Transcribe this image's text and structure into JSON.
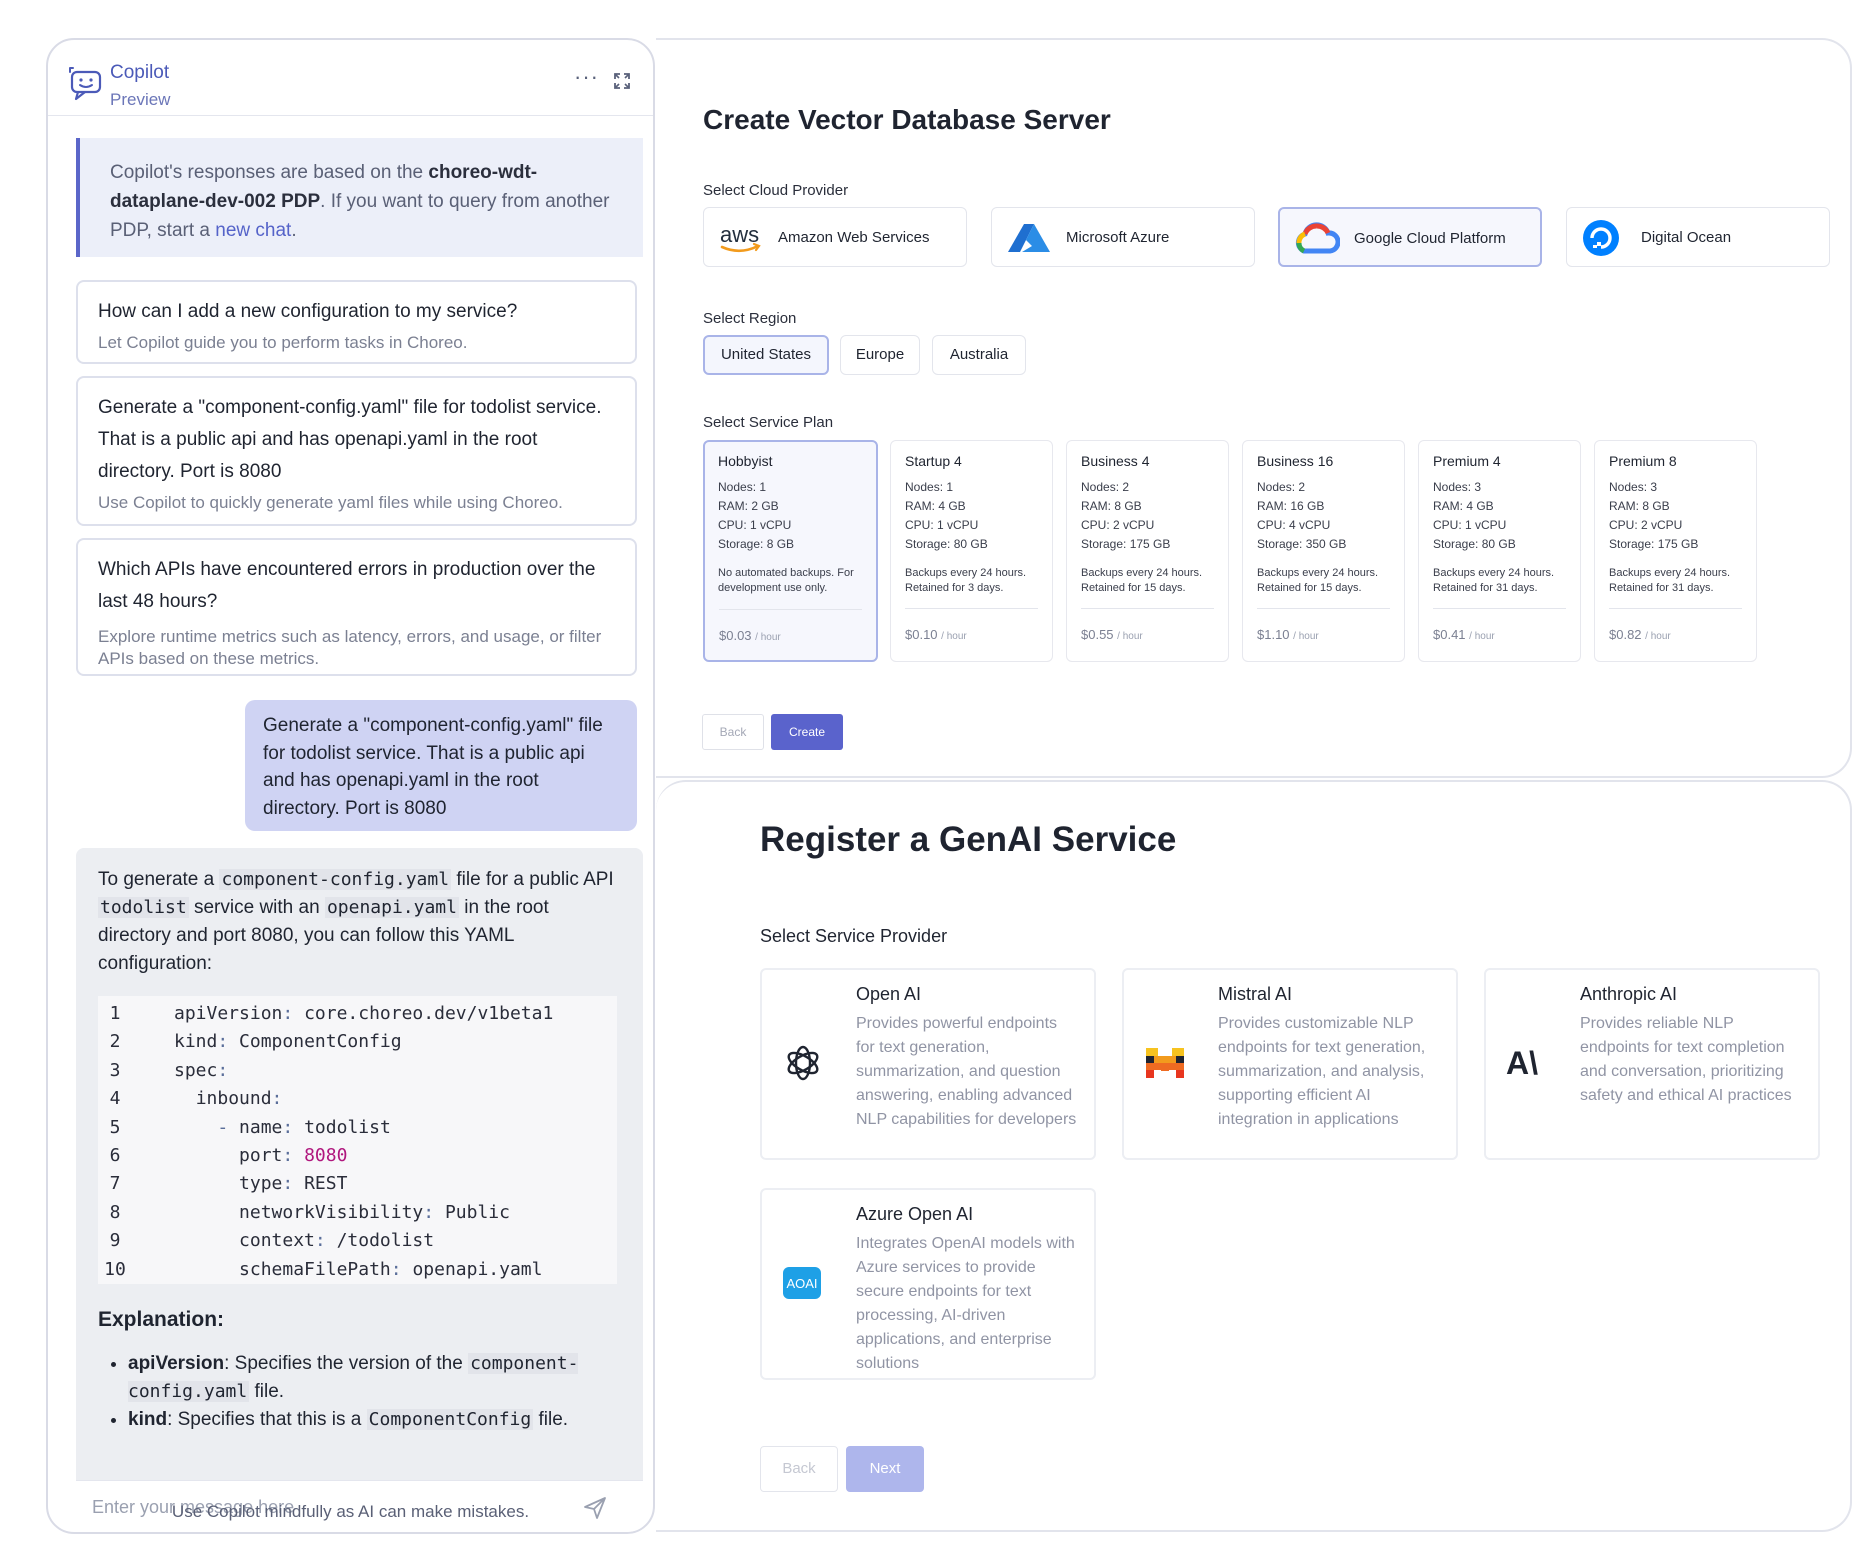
{
  "copilot": {
    "title": "Copilot",
    "subtitle": "Preview",
    "more": "···",
    "info": {
      "prefix": "Copilot's responses are based on the ",
      "pdp": "choreo-wdt-dataplane-dev-002 PDP",
      "middle": ". If you want to query from another PDP, start a ",
      "link": "new chat",
      "suffix": "."
    },
    "suggestions": [
      {
        "question": "How can I add a new configuration to my service?",
        "desc": "Let Copilot guide you to perform tasks in Choreo."
      },
      {
        "question": "Generate a \"component-config.yaml\" file for todolist service. That is a public api and has openapi.yaml in the root directory. Port is 8080",
        "desc": "Use Copilot to quickly generate yaml files while using Choreo."
      },
      {
        "question": "Which APIs have encountered errors in production over the last 48 hours?",
        "desc": "Explore runtime metrics such as latency, errors, and usage, or filter APIs based on these metrics."
      }
    ],
    "user_message": "Generate a \"component-config.yaml\" file for todolist service. That is a public api and has openapi.yaml in the root directory. Port is 8080",
    "response": {
      "t1": "To generate a ",
      "c1": "component-config.yaml",
      "t2": " file for a public API ",
      "c2": "todolist",
      "t3": " service with an ",
      "c3": "openapi.yaml",
      "t4": " in the root directory and port 8080, you can follow this YAML configuration:",
      "code": [
        {
          "n": "1",
          "indent": "",
          "dash": "",
          "key": "apiVersion",
          "val": "core.choreo.dev/v1beta1"
        },
        {
          "n": "2",
          "indent": "",
          "dash": "",
          "key": "kind",
          "val": "ComponentConfig"
        },
        {
          "n": "3",
          "indent": "",
          "dash": "",
          "key": "spec",
          "val": ""
        },
        {
          "n": "4",
          "indent": "  ",
          "dash": "",
          "key": "inbound",
          "val": ""
        },
        {
          "n": "5",
          "indent": "    ",
          "dash": "- ",
          "key": "name",
          "val": "todolist"
        },
        {
          "n": "6",
          "indent": "      ",
          "dash": "",
          "key": "port",
          "val": "8080"
        },
        {
          "n": "7",
          "indent": "      ",
          "dash": "",
          "key": "type",
          "val": "REST"
        },
        {
          "n": "8",
          "indent": "      ",
          "dash": "",
          "key": "networkVisibility",
          "val": "Public"
        },
        {
          "n": "9",
          "indent": "      ",
          "dash": "",
          "key": "context",
          "val": "/todolist"
        },
        {
          "n": "10",
          "indent": "      ",
          "dash": "",
          "key": "schemaFilePath",
          "val": "openapi.yaml"
        }
      ],
      "explanation_title": "Explanation:",
      "bullets": [
        {
          "term": "apiVersion",
          "text1": ": Specifies the version of the ",
          "code": "component-config.yaml",
          "text2": " file."
        },
        {
          "term": "kind",
          "text1": ": Specifies that this is a ",
          "code": "ComponentConfig",
          "text2": " file."
        }
      ]
    },
    "input_placeholder": "Enter your message here",
    "footer": "Use Copilot mindfully as AI can make mistakes."
  },
  "vector_db": {
    "title": "Create Vector Database Server",
    "cloud_label": "Select Cloud Provider",
    "providers": [
      {
        "name": "Amazon Web Services",
        "icon": "aws-icon"
      },
      {
        "name": "Microsoft Azure",
        "icon": "azure-icon"
      },
      {
        "name": "Google Cloud Platform",
        "icon": "google-cloud-icon",
        "selected": true
      },
      {
        "name": "Digital Ocean",
        "icon": "digital-ocean-icon"
      }
    ],
    "aws_text": "aws",
    "region_label": "Select Region",
    "regions": [
      "United States",
      "Europe",
      "Australia"
    ],
    "selected_region": "United States",
    "plan_label": "Select Service Plan",
    "plans": [
      {
        "name": "Hobbyist",
        "nodes": "Nodes: 1",
        "ram": "RAM: 2 GB",
        "cpu": "CPU: 1 vCPU",
        "storage": "Storage: 8 GB",
        "backup": "No automated backups. For development use only.",
        "price": "$0.03",
        "unit": "/ hour"
      },
      {
        "name": "Startup 4",
        "nodes": "Nodes: 1",
        "ram": "RAM: 4 GB",
        "cpu": "CPU: 1 vCPU",
        "storage": "Storage: 80 GB",
        "backup": "Backups every 24 hours. Retained for 3 days.",
        "price": "$0.10",
        "unit": "/ hour"
      },
      {
        "name": "Business 4",
        "nodes": "Nodes: 2",
        "ram": "RAM: 8 GB",
        "cpu": "CPU: 2 vCPU",
        "storage": "Storage: 175 GB",
        "backup": "Backups every 24 hours. Retained for 15 days.",
        "price": "$0.55",
        "unit": "/ hour"
      },
      {
        "name": "Business 16",
        "nodes": "Nodes: 2",
        "ram": "RAM: 16 GB",
        "cpu": "CPU: 4 vCPU",
        "storage": "Storage: 350 GB",
        "backup": "Backups every 24 hours. Retained for 15 days.",
        "price": "$1.10",
        "unit": "/ hour"
      },
      {
        "name": "Premium 4",
        "nodes": "Nodes: 3",
        "ram": "RAM: 4 GB",
        "cpu": "CPU: 1 vCPU",
        "storage": "Storage: 80 GB",
        "backup": "Backups every 24 hours. Retained for 31 days.",
        "price": "$0.41",
        "unit": "/ hour"
      },
      {
        "name": "Premium 8",
        "nodes": "Nodes: 3",
        "ram": "RAM: 8 GB",
        "cpu": "CPU: 2 vCPU",
        "storage": "Storage: 175 GB",
        "backup": "Backups every 24 hours. Retained for 31 days.",
        "price": "$0.82",
        "unit": "/ hour"
      }
    ],
    "selected_plan": "Hobbyist",
    "back_label": "Back",
    "create_label": "Create"
  },
  "genai": {
    "title": "Register a GenAI Service",
    "provider_label": "Select Service Provider",
    "providers": [
      {
        "name": "Open AI",
        "icon": "openai-icon",
        "desc": "Provides powerful endpoints for text generation, summarization, and question answering, enabling advanced NLP capabilities for developers"
      },
      {
        "name": "Mistral AI",
        "icon": "mistral-icon",
        "desc": "Provides customizable NLP endpoints for text generation, summarization, and analysis, supporting efficient AI integration in applications"
      },
      {
        "name": "Anthropic AI",
        "icon": "anthropic-icon",
        "desc": "Provides reliable NLP endpoints for text completion and conversation, prioritizing safety and ethical AI practices"
      },
      {
        "name": "Azure Open AI",
        "icon": "azure-openai-icon",
        "desc": "Integrates OpenAI models with Azure services to provide secure endpoints for text processing, AI-driven applications, and enterprise solutions"
      }
    ],
    "anthropic_logo_text": "A\\",
    "aoai_logo_text": "AOAI",
    "back_label": "Back",
    "next_label": "Next"
  }
}
